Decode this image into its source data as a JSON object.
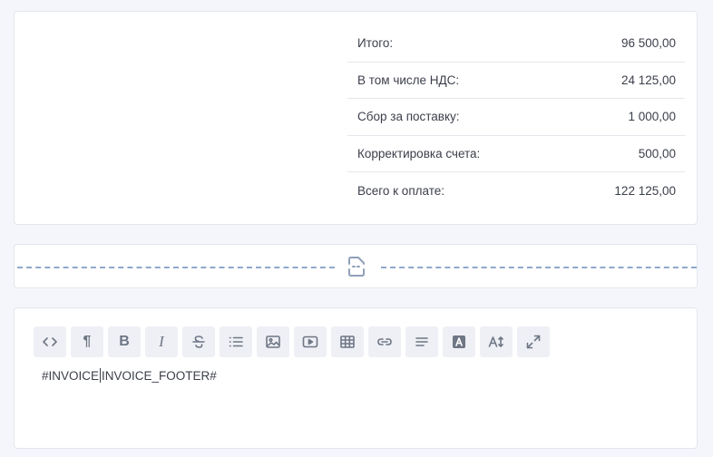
{
  "totals": {
    "rows": [
      {
        "label": "Итого:",
        "value": "96 500,00"
      },
      {
        "label": "В том числе НДС:",
        "value": "24 125,00"
      },
      {
        "label": "Сбор за поставку:",
        "value": "1 000,00"
      },
      {
        "label": "Корректировка счета:",
        "value": "500,00"
      },
      {
        "label": "Всего к оплате:",
        "value": "122 125,00"
      }
    ]
  },
  "divider": {
    "icon": "page-break-icon"
  },
  "editor": {
    "toolbar": [
      {
        "name": "code-view-icon"
      },
      {
        "name": "paragraph-icon",
        "glyph": "¶"
      },
      {
        "name": "bold-icon",
        "glyph": "B"
      },
      {
        "name": "italic-icon",
        "glyph": "I"
      },
      {
        "name": "strikethrough-icon"
      },
      {
        "name": "list-icon"
      },
      {
        "name": "image-icon"
      },
      {
        "name": "video-icon"
      },
      {
        "name": "table-icon"
      },
      {
        "name": "link-icon"
      },
      {
        "name": "align-icon"
      },
      {
        "name": "font-color-icon"
      },
      {
        "name": "font-size-icon"
      },
      {
        "name": "fullscreen-icon"
      }
    ],
    "content_before_caret": "#INVOICE",
    "content_after_caret": "INVOICE_FOOTER#"
  },
  "colors": {
    "accent": "#8fa8cc",
    "text": "#3b3f4a",
    "background": "#f5f6fb"
  }
}
